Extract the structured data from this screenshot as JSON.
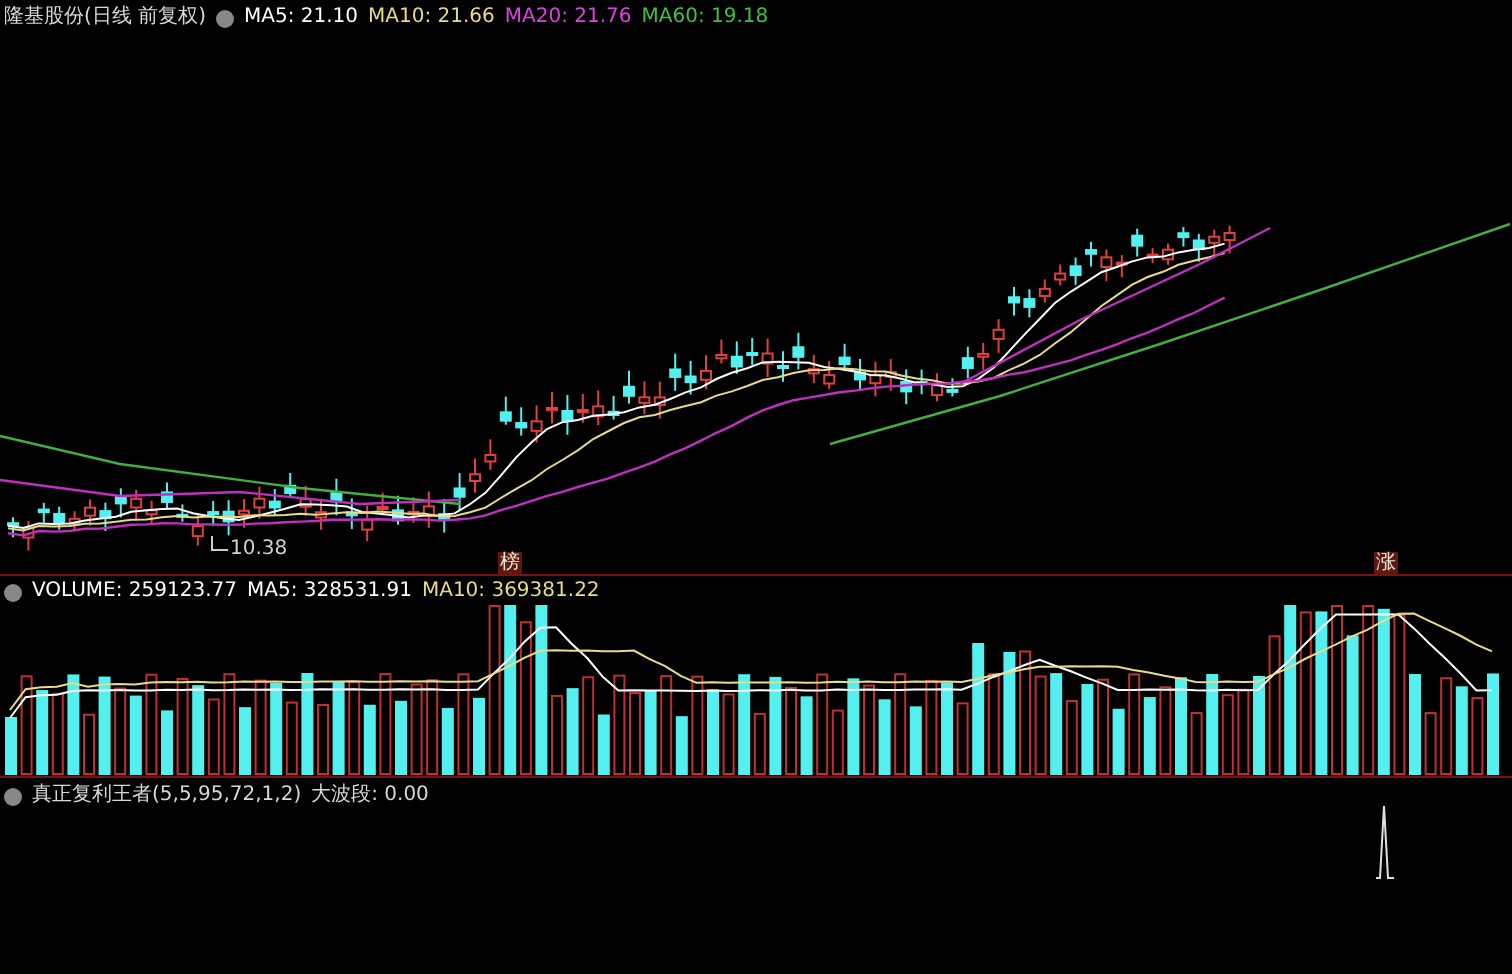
{
  "main_panel": {
    "title": "隆基股份(日线 前复权)",
    "indicators": [
      {
        "label": "MA5: 21.10",
        "color": "#ffffff"
      },
      {
        "label": "MA10: 21.66",
        "color": "#e6dc8a"
      },
      {
        "label": "MA20: 21.76",
        "color": "#e040e0"
      },
      {
        "label": "MA60: 19.18",
        "color": "#40c040"
      }
    ],
    "low_label": "10.38",
    "markers": [
      {
        "text": "榜"
      },
      {
        "text": "涨"
      }
    ]
  },
  "volume_panel": {
    "indicators": [
      {
        "label": "VOLUME: 259123.77",
        "color": "#ffffff"
      },
      {
        "label": "MA5: 328531.91",
        "color": "#ffffff"
      },
      {
        "label": "MA10: 369381.22",
        "color": "#e6dc8a"
      }
    ]
  },
  "indicator_panel": {
    "title": "真正复利王者(5,5,95,72,1,2)",
    "reading": "大波段: 0.00"
  }
}
